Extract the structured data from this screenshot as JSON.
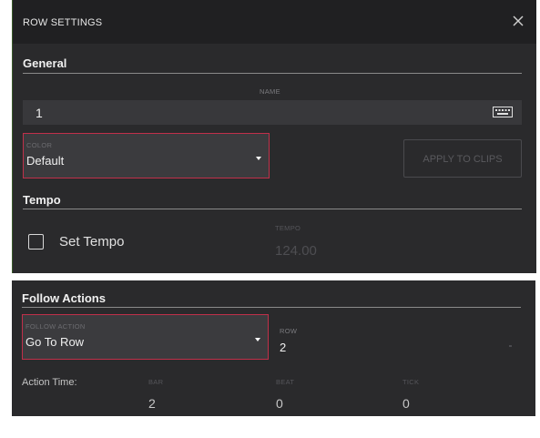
{
  "dialog": {
    "title": "ROW SETTINGS",
    "close_icon": "close-icon"
  },
  "general": {
    "heading": "General",
    "name_label": "NAME",
    "name_value": "1",
    "keyboard_icon": "keyboard-icon",
    "color_label": "COLOR",
    "color_value": "Default",
    "apply_label": "APPLY TO CLIPS"
  },
  "tempo": {
    "heading": "Tempo",
    "set_tempo_label": "Set Tempo",
    "set_tempo_checked": false,
    "tempo_label": "TEMPO",
    "tempo_value": "124.00"
  },
  "follow": {
    "heading": "Follow Actions",
    "action_label": "FOLLOW ACTION",
    "action_value": "Go To Row",
    "row_label": "ROW",
    "row_value": "2",
    "action_time_label": "Action Time:",
    "bar_label": "BAR",
    "bar_value": "2",
    "beat_label": "BEAT",
    "beat_value": "0",
    "tick_label": "TICK",
    "tick_value": "0"
  },
  "colors": {
    "panel": "#2a2a2c",
    "titlebar": "#202022",
    "field": "#38383b",
    "accent_border": "#c0304a"
  }
}
